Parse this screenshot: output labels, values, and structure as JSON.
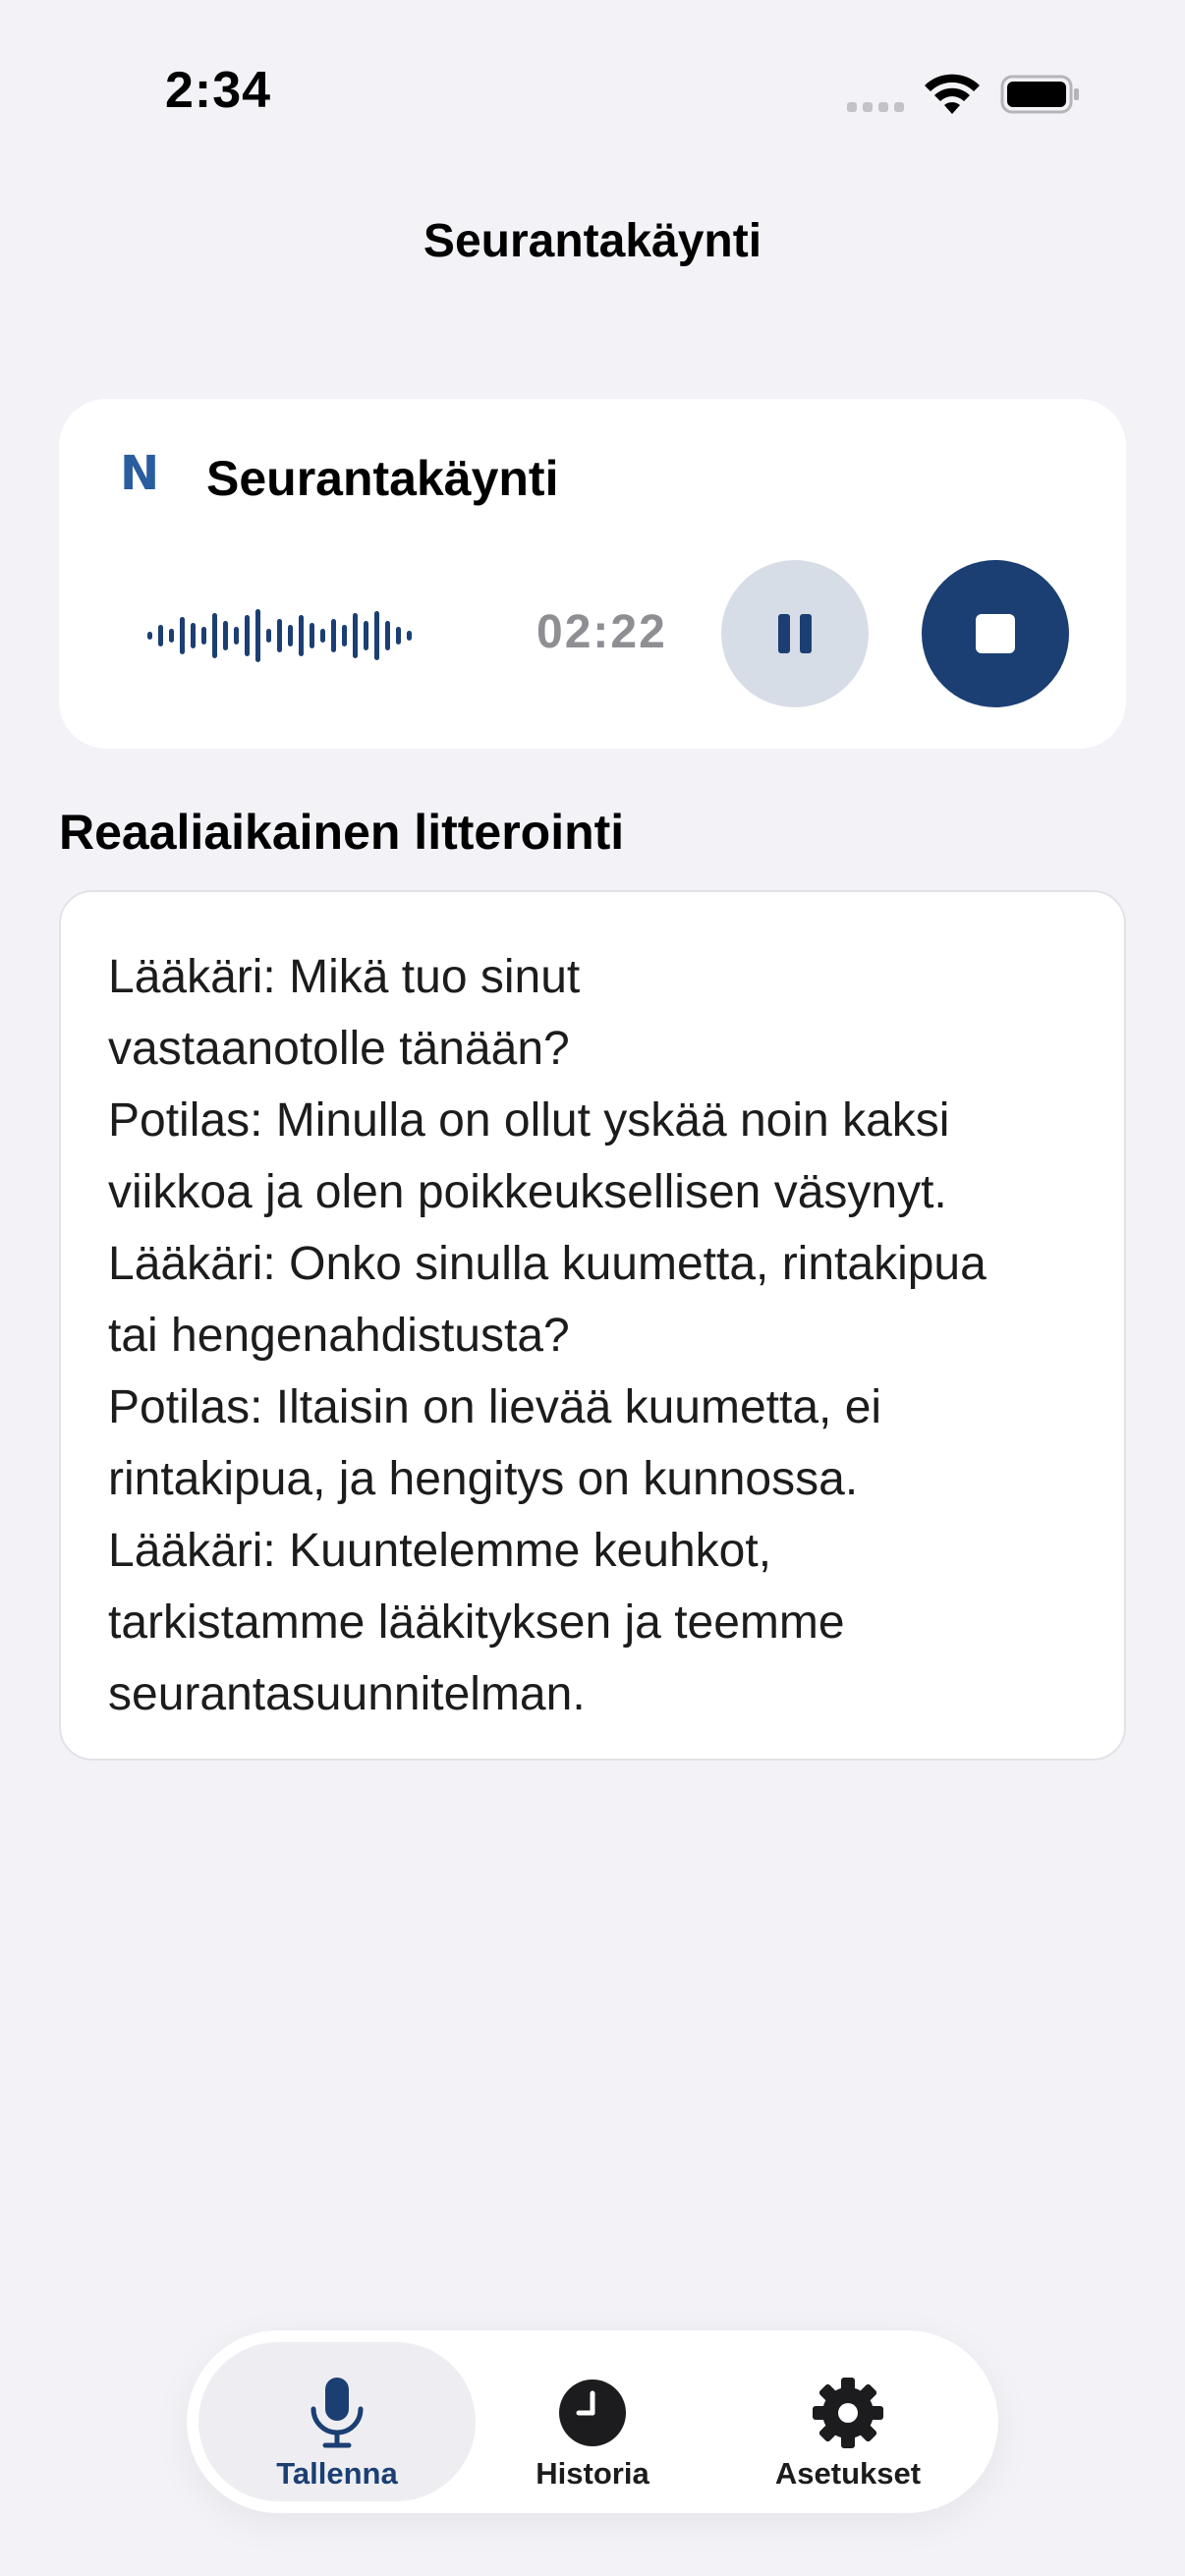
{
  "status_bar": {
    "time": "2:34"
  },
  "nav": {
    "title": "Seurantakäynti"
  },
  "recorder": {
    "logo_letter": "N",
    "title": "Seurantakäynti",
    "elapsed": "02:22",
    "pause_icon": "pause-icon",
    "stop_icon": "stop-icon"
  },
  "transcript": {
    "heading": "Reaaliaikainen litterointi",
    "text": "Lääkäri: Mikä tuo sinut\nvastaanotolle tänään?\nPotilas: Minulla on ollut yskää noin kaksi\nviikkoa ja olen poikkeuksellisen väsynyt.\nLääkäri: Onko sinulla kuumetta, rintakipua\ntai hengenahdistusta?\nPotilas: Iltaisin on lievää kuumetta, ei\nrintakipua, ja hengitys on kunnossa.\nLääkäri: Kuuntelemme keuhkot,\ntarkistamme lääkityksen ja teemme\nseurantasuunnitelman."
  },
  "tabs": [
    {
      "label": "Tallenna",
      "icon": "microphone-icon",
      "active": true
    },
    {
      "label": "Historia",
      "icon": "clock-icon",
      "active": false
    },
    {
      "label": "Asetukset",
      "icon": "gear-icon",
      "active": false
    }
  ],
  "colors": {
    "background": "#f2f2f7",
    "accent": "#1b3f73",
    "logo": "#2a5d9e",
    "pause_bg": "#d7dde6",
    "timer": "#8e8e93"
  }
}
